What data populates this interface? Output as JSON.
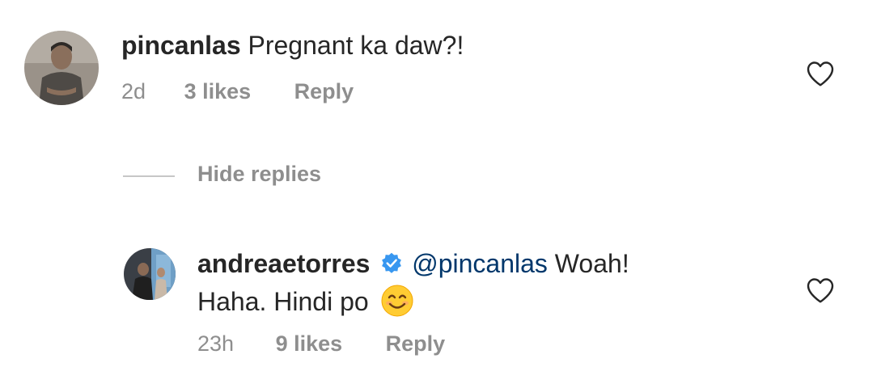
{
  "comment": {
    "username": "pincanlas",
    "text": "Pregnant ka daw?!",
    "time": "2d",
    "likes": "3 likes",
    "reply_label": "Reply"
  },
  "replies_toggle": {
    "label": "Hide replies"
  },
  "reply": {
    "username": "andreaetorres",
    "verified": true,
    "mention": "@pincanlas",
    "text_line1": "Woah!",
    "text_line2": "Haha. Hindi po",
    "emoji": "😊",
    "time": "23h",
    "likes": "9 likes",
    "reply_label": "Reply"
  },
  "colors": {
    "text": "#262626",
    "meta": "#8e8e8e",
    "mention": "#00376b",
    "verified_badge": "#3897f0"
  },
  "icons": [
    "heart-outline-icon",
    "verified-badge-icon",
    "smiling-face-emoji"
  ]
}
